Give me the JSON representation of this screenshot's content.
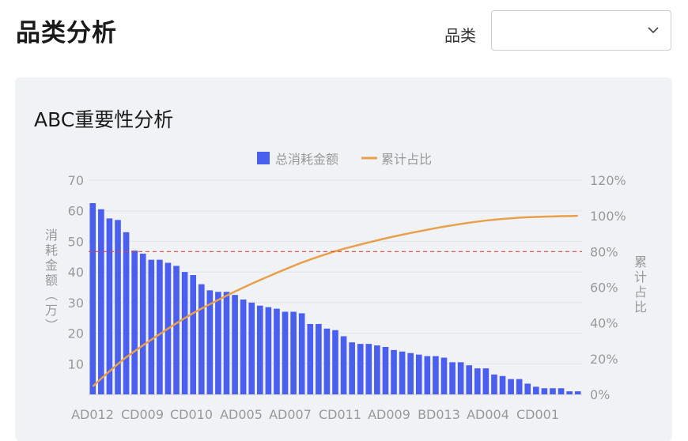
{
  "page": {
    "title": "品类分析",
    "filter_label": "品类",
    "filter_value": ""
  },
  "card": {
    "title": "ABC重要性分析"
  },
  "colors": {
    "bar": "#4a5ef0",
    "line": "#e8a04a",
    "threshold": "#d84a3a",
    "grid": "#e2e4ea"
  },
  "chart_data": {
    "type": "bar",
    "legend": [
      "总消耗金额",
      "累计占比"
    ],
    "legend_position": "top-center",
    "ylabel": "消耗金额（万）",
    "y2label": "累计占比",
    "ylim": [
      0,
      70
    ],
    "y_ticks": [
      "10",
      "20",
      "30",
      "40",
      "50",
      "60",
      "70"
    ],
    "y2lim": [
      0,
      120
    ],
    "y2_ticks": [
      "0%",
      "20%",
      "40%",
      "60%",
      "80%",
      "100%",
      "120%"
    ],
    "x_tick_labels": [
      "AD012",
      "CD009",
      "CD010",
      "AD005",
      "AD007",
      "CD011",
      "AD009",
      "BD013",
      "AD004",
      "CD001"
    ],
    "threshold_pct": 80,
    "grid": true,
    "values": [
      62.5,
      60.5,
      57.5,
      57,
      53,
      47,
      46,
      44,
      44,
      43,
      42,
      40,
      39,
      36,
      34,
      33.5,
      33.5,
      32.5,
      31,
      30,
      29,
      28.5,
      28,
      27,
      27,
      26.5,
      23,
      23,
      21.5,
      21,
      19,
      17,
      16.5,
      16.5,
      16,
      15.5,
      14.5,
      14,
      13.5,
      13,
      12.5,
      12.5,
      12,
      10.5,
      10.5,
      9.5,
      8.5,
      8.5,
      6.5,
      6,
      5,
      5,
      3.5,
      2.5,
      2,
      2,
      2,
      1,
      1
    ]
  }
}
